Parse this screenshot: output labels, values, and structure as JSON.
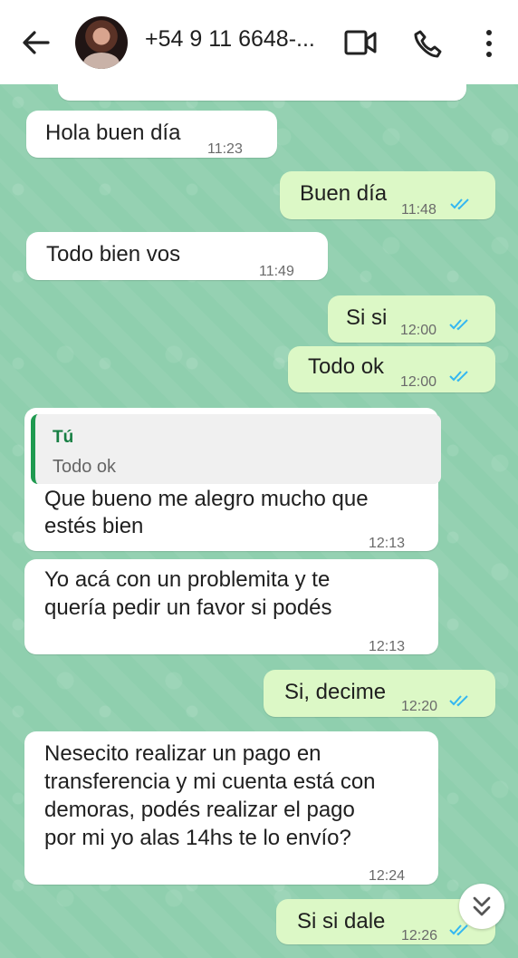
{
  "header": {
    "contact_name": "+54 9 11 6648-...",
    "back_icon": "arrow-left-icon",
    "video_icon": "video-call-icon",
    "phone_icon": "voice-call-icon",
    "menu_icon": "more-vertical-icon"
  },
  "messages": [
    {
      "direction": "incoming",
      "text": "Hola buen día",
      "time": "11:23"
    },
    {
      "direction": "outgoing",
      "text": "Buen día",
      "time": "11:48",
      "status": "read"
    },
    {
      "direction": "incoming",
      "text": "Todo bien vos",
      "time": "11:49"
    },
    {
      "direction": "outgoing",
      "text": "Si si",
      "time": "12:00",
      "status": "read"
    },
    {
      "direction": "outgoing",
      "text": "Todo ok",
      "time": "12:00",
      "status": "read"
    },
    {
      "direction": "incoming",
      "reply": {
        "author": "Tú",
        "text": "Todo ok"
      },
      "lines": [
        "Que bueno me alegro mucho que",
        "estés bien"
      ],
      "time": "12:13"
    },
    {
      "direction": "incoming",
      "lines": [
        "Yo acá con un problemita y te",
        "quería pedir un favor si podés"
      ],
      "time": "12:13"
    },
    {
      "direction": "outgoing",
      "text": "Si, decime",
      "time": "12:20",
      "status": "read"
    },
    {
      "direction": "incoming",
      "lines": [
        "Nesecito realizar un pago en",
        "transferencia y mi cuenta está con",
        "demoras, podés realizar el pago",
        "por mi yo alas 14hs te lo envío?"
      ],
      "time": "12:24"
    },
    {
      "direction": "outgoing",
      "text": "Si si dale",
      "time": "12:26",
      "status": "read"
    }
  ],
  "colors": {
    "chat_background": "#8fcfae",
    "incoming_bubble": "#ffffff",
    "outgoing_bubble": "#dcf8c6",
    "read_ticks": "#34b7f1",
    "reply_accent": "#1f9a50"
  },
  "scroll_button_icon": "chevrons-down-icon"
}
